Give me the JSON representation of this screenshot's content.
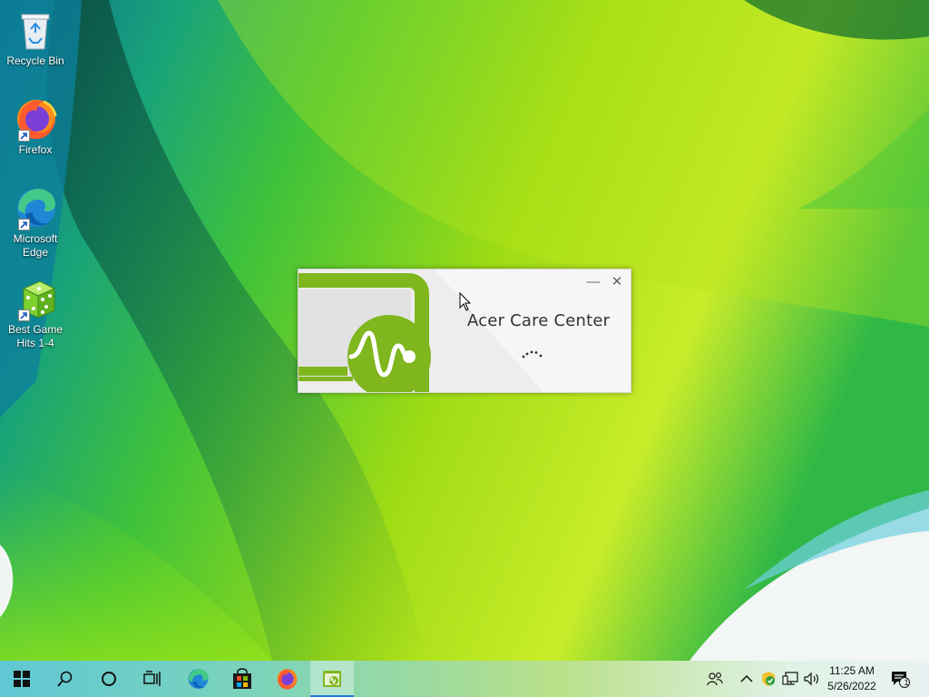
{
  "desktop": {
    "icons": [
      {
        "label": "Recycle Bin",
        "icon": "recycle-bin-icon"
      },
      {
        "label": "Firefox",
        "icon": "firefox-icon"
      },
      {
        "label": "Microsoft Edge",
        "icon": "edge-icon"
      },
      {
        "label": "Best Game Hits 1-4",
        "icon": "game-dice-icon"
      }
    ]
  },
  "splash": {
    "title": "Acer Care Center",
    "minimize_glyph": "—",
    "close_glyph": "✕",
    "accent": "#80b61e"
  },
  "taskbar": {
    "buttons": [
      {
        "name": "start-button",
        "icon": "windows-logo-icon"
      },
      {
        "name": "search-button",
        "icon": "search-icon"
      },
      {
        "name": "cortana-button",
        "icon": "cortana-circle-icon"
      },
      {
        "name": "task-view-button",
        "icon": "task-view-icon"
      },
      {
        "name": "edge-taskbar-button",
        "icon": "edge-icon"
      },
      {
        "name": "store-taskbar-button",
        "icon": "store-icon"
      },
      {
        "name": "firefox-taskbar-button",
        "icon": "firefox-icon"
      },
      {
        "name": "acer-care-center-taskbar-button",
        "icon": "acer-care-center-icon",
        "active": true
      }
    ],
    "tray": {
      "icons": [
        "people-icon",
        "chevron-up-icon",
        "security-icon",
        "network-icon",
        "volume-icon"
      ],
      "time": "11:25 AM",
      "date": "5/26/2022",
      "notification_count": "1"
    }
  }
}
